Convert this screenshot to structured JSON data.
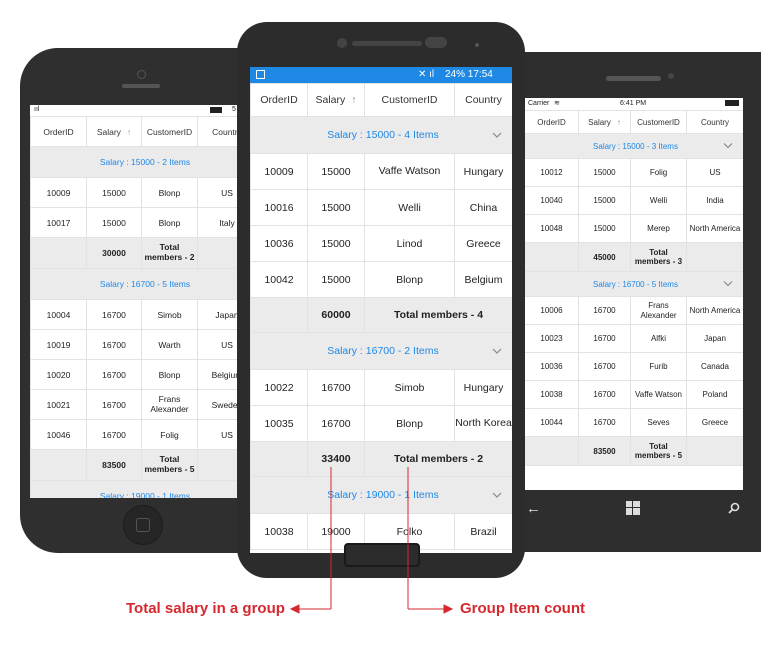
{
  "colors": {
    "accent": "#1e88e5",
    "annotation": "#d6282f",
    "phone_body": "#303030",
    "group_bg": "#ebebeb"
  },
  "left_phone": {
    "status_right": "5",
    "headers": [
      "OrderID",
      "Salary",
      "CustomerID",
      "Country"
    ],
    "groups": [
      {
        "caption": "Salary : 15000 - 2 Items",
        "rows": [
          [
            "10009",
            "15000",
            "Blonp",
            "US"
          ],
          [
            "10017",
            "15000",
            "Blonp",
            "Italy"
          ]
        ],
        "summary_salary": "30000",
        "summary_text": "Total members - 2"
      },
      {
        "caption": "Salary : 16700 - 5 Items",
        "rows": [
          [
            "10004",
            "16700",
            "Simob",
            "Japan"
          ],
          [
            "10019",
            "16700",
            "Warth",
            "US"
          ],
          [
            "10020",
            "16700",
            "Blonp",
            "Belgium"
          ],
          [
            "10021",
            "16700",
            "Frans Alexander",
            "Sweden"
          ],
          [
            "10046",
            "16700",
            "Folig",
            "US"
          ]
        ],
        "summary_salary": "83500",
        "summary_text": "Total members - 5"
      }
    ],
    "trailing_caption": "Salary : 19000 - 1 Items"
  },
  "center_phone": {
    "status_text": "24% 17:54",
    "headers": [
      "OrderID",
      "Salary",
      "CustomerID",
      "Country"
    ],
    "groups": [
      {
        "caption": "Salary : 15000 - 4 Items",
        "rows": [
          [
            "10009",
            "15000",
            "Vaffe Watson",
            "Hungary"
          ],
          [
            "10016",
            "15000",
            "Welli",
            "China"
          ],
          [
            "10036",
            "15000",
            "Linod",
            "Greece"
          ],
          [
            "10042",
            "15000",
            "Blonp",
            "Belgium"
          ]
        ],
        "summary_salary": "60000",
        "summary_text": "Total members - 4"
      },
      {
        "caption": "Salary : 16700 - 2 Items",
        "rows": [
          [
            "10022",
            "16700",
            "Simob",
            "Hungary"
          ],
          [
            "10035",
            "16700",
            "Blonp",
            "North Korea"
          ]
        ],
        "summary_salary": "33400",
        "summary_text": "Total members - 2"
      }
    ],
    "trailing_caption": "Salary : 19000 - 1 Items",
    "trailing_row": [
      "10038",
      "19000",
      "Folko",
      "Brazil"
    ]
  },
  "right_phone": {
    "carrier": "Carrier",
    "time": "6:41 PM",
    "headers": [
      "OrderID",
      "Salary",
      "CustomerID",
      "Country"
    ],
    "groups": [
      {
        "caption": "Salary : 15000 - 3 Items",
        "rows": [
          [
            "10012",
            "15000",
            "Folig",
            "US"
          ],
          [
            "10040",
            "15000",
            "Welli",
            "India"
          ],
          [
            "10048",
            "15000",
            "Merep",
            "North America"
          ]
        ],
        "summary_salary": "45000",
        "summary_text": "Total members - 3"
      },
      {
        "caption": "Salary : 16700 - 5 Items",
        "rows": [
          [
            "10006",
            "16700",
            "Frans Alexander",
            "North America"
          ],
          [
            "10023",
            "16700",
            "Alfki",
            "Japan"
          ],
          [
            "10036",
            "16700",
            "Furib",
            "Canada"
          ],
          [
            "10038",
            "16700",
            "Vaffe Watson",
            "Poland"
          ],
          [
            "10044",
            "16700",
            "Seves",
            "Greece"
          ]
        ],
        "summary_salary": "83500",
        "summary_text": "Total members - 5"
      }
    ]
  },
  "annotations": {
    "left": "Total salary in a group",
    "right": "Group Item count"
  },
  "icons": {
    "sort": "arrow-up-icon",
    "chevron": "chevron-down-icon",
    "back": "back-arrow-icon",
    "windows": "windows-logo-icon",
    "search": "search-icon",
    "home": "home-button-icon"
  }
}
